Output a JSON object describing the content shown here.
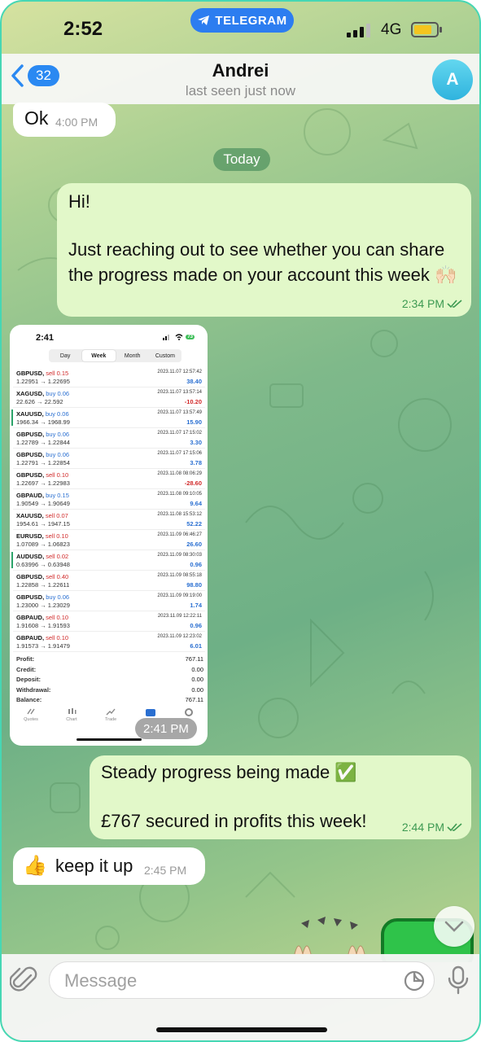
{
  "status_bar": {
    "time": "2:52",
    "app_pill": "TELEGRAM",
    "network": "4G"
  },
  "header": {
    "back_count": "32",
    "name": "Andrei",
    "status": "last seen just now",
    "avatar_letter": "A"
  },
  "messages": {
    "m1": {
      "text": "Ok",
      "time": "4:00 PM"
    },
    "date_divider": "Today",
    "m2": {
      "line1": "Hi!",
      "line2": "Just reaching out to see whether you can share the progress made on your account this week 🙌🏻",
      "time": "2:34 PM"
    },
    "m3_image_time": "2:41 PM",
    "m4": {
      "line1": "Steady progress being made ✅",
      "line2": "£767 secured in profits this week!",
      "time": "2:44 PM"
    },
    "m5": {
      "emoji": "👍",
      "text": "keep it up",
      "time": "2:45 PM"
    }
  },
  "screenshot": {
    "time": "2:41",
    "battery": "73",
    "tabs": [
      "Day",
      "Week",
      "Month",
      "Custom"
    ],
    "active_tab": "Week",
    "trades": [
      {
        "symbol": "GBPUSD,",
        "side": "sell 0.15",
        "dir": "sell",
        "prices": "1.22951 → 1.22695",
        "date": "2023.11.07 12:57:42",
        "profit": "38.40"
      },
      {
        "symbol": "XAGUSD,",
        "side": "buy 0.06",
        "dir": "buy",
        "prices": "22.626 → 22.592",
        "date": "2023.11.07 13:57:14",
        "profit": "-10.20"
      },
      {
        "symbol": "XAUUSD,",
        "side": "buy 0.06",
        "dir": "buy",
        "prices": "1966.34 → 1968.99",
        "date": "2023.11.07 13:57:49",
        "profit": "15.90"
      },
      {
        "symbol": "GBPUSD,",
        "side": "buy 0.06",
        "dir": "buy",
        "prices": "1.22789 → 1.22844",
        "date": "2023.11.07 17:15:02",
        "profit": "3.30"
      },
      {
        "symbol": "GBPUSD,",
        "side": "buy 0.06",
        "dir": "buy",
        "prices": "1.22791 → 1.22854",
        "date": "2023.11.07 17:15:06",
        "profit": "3.78"
      },
      {
        "symbol": "GBPUSD,",
        "side": "sell 0.10",
        "dir": "sell",
        "prices": "1.22697 → 1.22983",
        "date": "2023.11.08 08:06:29",
        "profit": "-28.60"
      },
      {
        "symbol": "GBPAUD,",
        "side": "buy 0.15",
        "dir": "buy",
        "prices": "1.90549 → 1.90649",
        "date": "2023.11.08 09:10:05",
        "profit": "9.64"
      },
      {
        "symbol": "XAUUSD,",
        "side": "sell 0.07",
        "dir": "sell",
        "prices": "1954.61 → 1947.15",
        "date": "2023.11.08 15:53:12",
        "profit": "52.22"
      },
      {
        "symbol": "EURUSD,",
        "side": "sell 0.10",
        "dir": "sell",
        "prices": "1.07089 → 1.06823",
        "date": "2023.11.09 06:46:27",
        "profit": "26.60"
      },
      {
        "symbol": "AUDUSD,",
        "side": "sell 0.02",
        "dir": "sell",
        "prices": "0.63996 → 0.63948",
        "date": "2023.11.09 08:30:03",
        "profit": "0.96"
      },
      {
        "symbol": "GBPUSD,",
        "side": "sell 0.40",
        "dir": "sell",
        "prices": "1.22858 → 1.22611",
        "date": "2023.11.09 08:55:18",
        "profit": "98.80"
      },
      {
        "symbol": "GBPUSD,",
        "side": "buy 0.06",
        "dir": "buy",
        "prices": "1.23000 → 1.23029",
        "date": "2023.11.09 09:19:00",
        "profit": "1.74"
      },
      {
        "symbol": "GBPAUD,",
        "side": "sell 0.10",
        "dir": "sell",
        "prices": "1.91608 → 1.91593",
        "date": "2023.11.09 12:22:11",
        "profit": "0.96"
      },
      {
        "symbol": "GBPAUD,",
        "side": "sell 0.10",
        "dir": "sell",
        "prices": "1.91573 → 1.91479",
        "date": "2023.11.09 12:23:02",
        "profit": "6.01"
      }
    ],
    "summary": [
      {
        "label": "Profit:",
        "value": "767.11"
      },
      {
        "label": "Credit:",
        "value": "0.00"
      },
      {
        "label": "Deposit:",
        "value": "0.00"
      },
      {
        "label": "Withdrawal:",
        "value": "0.00"
      },
      {
        "label": "Balance:",
        "value": "767.11"
      }
    ],
    "bottom_tabs": [
      "Quotes",
      "Chart",
      "Trade"
    ]
  },
  "input": {
    "placeholder": "Message"
  },
  "colors": {
    "accent": "#2a89f2",
    "outgoing_bubble": "#e2f8c9",
    "check_green": "#3d9a52"
  }
}
